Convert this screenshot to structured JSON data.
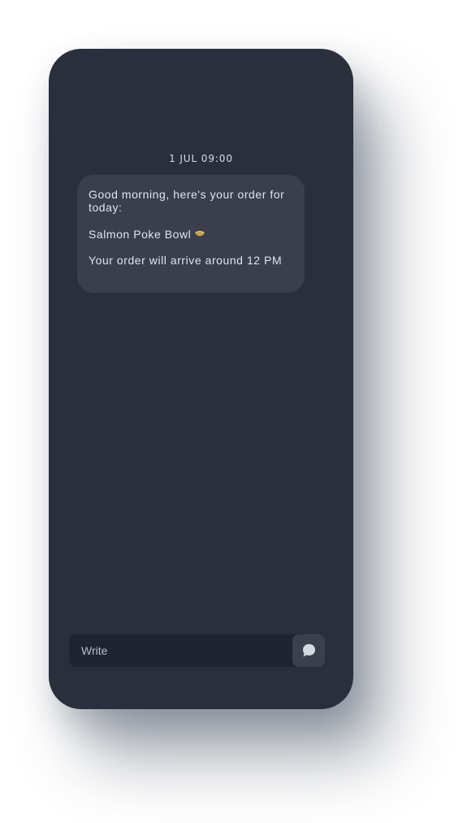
{
  "chat": {
    "timestamp": "1 JUL 09:00",
    "message": {
      "line1": "Good morning, here's your order for today:",
      "line2": "Salmon Poke Bowl",
      "line2_icon": "bowl-icon",
      "line3": "Your order will arrive around 12 PM"
    }
  },
  "composer": {
    "placeholder": "Write",
    "send_icon": "speech-bubble-icon"
  },
  "colors": {
    "phone_background": "#2a2f3d",
    "bubble_background": "#3a3f4d",
    "input_background": "#202430",
    "send_button_background": "#3b404e"
  }
}
